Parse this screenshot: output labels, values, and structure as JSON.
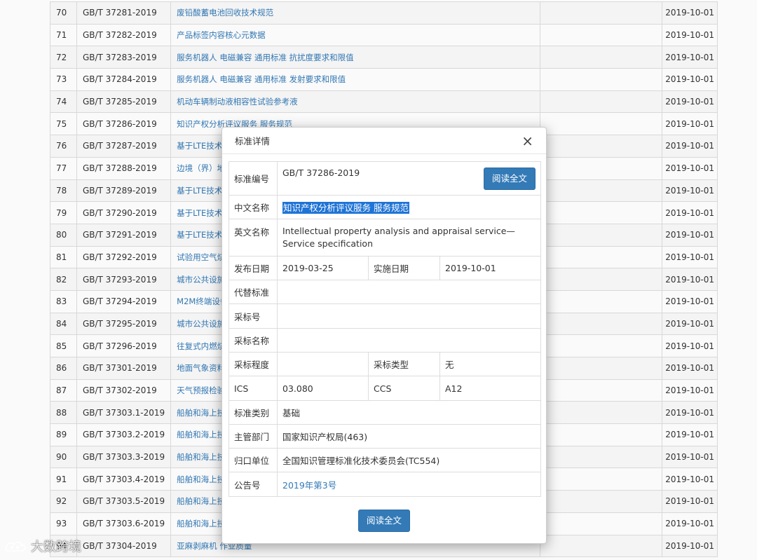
{
  "table": {
    "rows": [
      {
        "no": "70",
        "code": "GB/T 37281-2019",
        "name": "废铅酸蓄电池回收技术规范",
        "date": "2019-10-01"
      },
      {
        "no": "71",
        "code": "GB/T 37282-2019",
        "name": "产品标签内容核心元数据",
        "date": "2019-10-01"
      },
      {
        "no": "72",
        "code": "GB/T 37283-2019",
        "name": "服务机器人 电磁兼容 通用标准 抗扰度要求和限值",
        "date": "2019-10-01"
      },
      {
        "no": "73",
        "code": "GB/T 37284-2019",
        "name": "服务机器人 电磁兼容 通用标准 发射要求和限值",
        "date": "2019-10-01"
      },
      {
        "no": "74",
        "code": "GB/T 37285-2019",
        "name": "机动车辆制动液相容性试验参考液",
        "date": "2019-10-01"
      },
      {
        "no": "75",
        "code": "GB/T 37286-2019",
        "name": "知识产权分析评议服务 服务规范",
        "date": "2019-10-01"
      },
      {
        "no": "76",
        "code": "GB/T 37287-2019",
        "name": "基于LTE技术",
        "date": "2019-10-01"
      },
      {
        "no": "77",
        "code": "GB/T 37288-2019",
        "name": "边境（界）地",
        "date": "2019-10-01"
      },
      {
        "no": "78",
        "code": "GB/T 37289-2019",
        "name": "基于LTE技术",
        "date": "2019-10-01"
      },
      {
        "no": "79",
        "code": "GB/T 37290-2019",
        "name": "基于LTE技术",
        "date": "2019-10-01"
      },
      {
        "no": "80",
        "code": "GB/T 37291-2019",
        "name": "基于LTE技术",
        "date": "2019-10-01"
      },
      {
        "no": "81",
        "code": "GB/T 37292-2019",
        "name": "试验用空气烧",
        "date": "2019-10-01"
      },
      {
        "no": "82",
        "code": "GB/T 37293-2019",
        "name": "城市公共设施",
        "date": "2019-10-01"
      },
      {
        "no": "83",
        "code": "GB/T 37294-2019",
        "name": "M2M终端设备",
        "date": "2019-10-01"
      },
      {
        "no": "84",
        "code": "GB/T 37295-2019",
        "name": "城市公共设施",
        "date": "2019-10-01"
      },
      {
        "no": "85",
        "code": "GB/T 37296-2019",
        "name": "往复式内燃烧",
        "date": "2019-10-01"
      },
      {
        "no": "86",
        "code": "GB/T 37301-2019",
        "name": "地面气象资料",
        "date": "2019-10-01"
      },
      {
        "no": "87",
        "code": "GB/T 37302-2019",
        "name": "天气预报检验",
        "date": "2019-10-01"
      },
      {
        "no": "88",
        "code": "GB/T 37303.1-2019",
        "name": "船舶和海上技",
        "date": "2019-10-01"
      },
      {
        "no": "89",
        "code": "GB/T 37303.2-2019",
        "name": "船舶和海上技",
        "date": "2019-10-01"
      },
      {
        "no": "90",
        "code": "GB/T 37303.3-2019",
        "name": "船舶和海上技",
        "date": "2019-10-01"
      },
      {
        "no": "91",
        "code": "GB/T 37303.4-2019",
        "name": "船舶和海上技",
        "date": "2019-10-01"
      },
      {
        "no": "92",
        "code": "GB/T 37303.5-2019",
        "name": "船舶和海上技",
        "date": "2019-10-01"
      },
      {
        "no": "93",
        "code": "GB/T 37303.6-2019",
        "name": "船舶和海上技",
        "date": "2019-10-01"
      },
      {
        "no": "94",
        "code": "GB/T 37304-2019",
        "name": "亚麻剥麻机 作业质量",
        "date": "2019-10-01"
      }
    ]
  },
  "modal": {
    "title": "标准详情",
    "close_icon": "×",
    "read_button": "阅读全文",
    "fields": {
      "code_label": "标准编号",
      "code_value": "GB/T 37286-2019",
      "cn_name_label": "中文名称",
      "cn_name_value": "知识产权分析评议服务 服务规范",
      "en_name_label": "英文名称",
      "en_name_value": "Intellectual property analysis and appraisal service—Service specification",
      "pub_date_label": "发布日期",
      "pub_date_value": "2019-03-25",
      "impl_date_label": "实施日期",
      "impl_date_value": "2019-10-01",
      "replace_label": "代替标准",
      "replace_value": "",
      "adopt_no_label": "采标号",
      "adopt_no_value": "",
      "adopt_name_label": "采标名称",
      "adopt_name_value": "",
      "adopt_degree_label": "采标程度",
      "adopt_degree_value": "",
      "adopt_type_label": "采标类型",
      "adopt_type_value": "无",
      "ics_label": "ICS",
      "ics_value": "03.080",
      "ccs_label": "CCS",
      "ccs_value": "A12",
      "category_label": "标准类别",
      "category_value": "基础",
      "dept_label": "主管部门",
      "dept_value": "国家知识产权局(463)",
      "unit_label": "归口单位",
      "unit_value": "全国知识管理标准化技术委员会(TC554)",
      "notice_label": "公告号",
      "notice_value": "2019年第3号"
    }
  },
  "watermark": {
    "text": "大数跨境"
  },
  "colors": {
    "link": "#337ab7",
    "button": "#337ab7",
    "highlight": "#1f74d6"
  }
}
